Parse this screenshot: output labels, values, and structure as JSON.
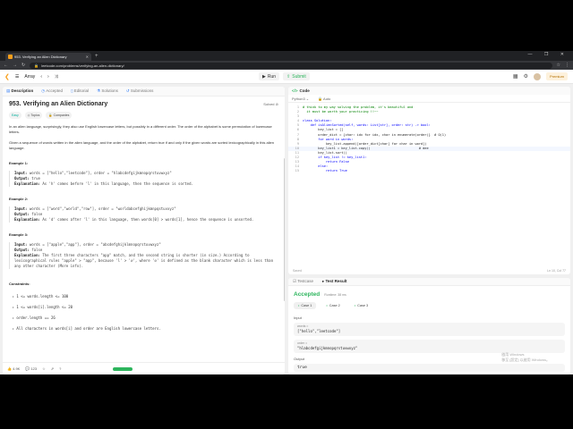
{
  "browser": {
    "tab_title": "953. Verifying an Alien Dictionary",
    "url": "leetcode.com/problems/verifying-an-alien-dictionary/"
  },
  "header": {
    "nav_label": "Array",
    "run_label": "Run",
    "submit_label": "Submit",
    "premium_label": "Premium"
  },
  "left_tabs": [
    "Description",
    "Accepted",
    "Editorial",
    "Solutions",
    "Submissions"
  ],
  "problem": {
    "title": "953. Verifying an Alien Dictionary",
    "solved_label": "Solved",
    "difficulty": "Easy",
    "tag_topics": "Topics",
    "tag_companies": "Companies",
    "desc1": "In an alien language, surprisingly, they also use English lowercase letters, but possibly in a different order. The order of the alphabet is some permutation of lowercase letters.",
    "desc2": "Given a sequence of words written in the alien language, and the order of the alphabet, return true if and only if the given words are sorted lexicographically in this alien language.",
    "examples": [
      {
        "title": "Example 1:",
        "input": "words = [\"hello\",\"leetcode\"], order = \"hlabcdefgijkmnopqrstuvwxyz\"",
        "output": "true",
        "explanation": "As 'h' comes before 'l' in this language, then the sequence is sorted."
      },
      {
        "title": "Example 2:",
        "input": "words = [\"word\",\"world\",\"row\"], order = \"worldabcefghijkmnpqstuvxyz\"",
        "output": "false",
        "explanation": "As 'd' comes after 'l' in this language, then words[0] > words[1], hence the sequence is unsorted."
      },
      {
        "title": "Example 3:",
        "input": "words = [\"apple\",\"app\"], order = \"abcdefghijklmnopqrstuvwxyz\"",
        "output": "false",
        "explanation": "The first three characters \"app\" match, and the second string is shorter (in size.) According to lexicographical rules \"apple\" > \"app\", because 'l' > '∅', where '∅' is defined as the blank character which is less than any other character (More info)."
      }
    ],
    "labels": {
      "input": "Input:",
      "output": "Output:",
      "explanation": "Explanation:"
    },
    "constraints_title": "Constraints:",
    "constraints": [
      "1 <= words.length <= 100",
      "1 <= words[i].length <= 20",
      "order.length == 26",
      "All characters in words[i] and order are English lowercase letters."
    ],
    "likes": "4.9K",
    "comments": "123"
  },
  "editor": {
    "title": "Code",
    "language": "Python3",
    "mode": "Auto",
    "lines": [
      {
        "n": "1",
        "type": "com",
        "text": "# think to my way solving the problem, it's beautiful and"
      },
      {
        "n": "2",
        "type": "com",
        "text": "  it must be worth your practicing !!~~"
      },
      {
        "n": "3",
        "type": "tx",
        "text": ""
      },
      {
        "n": "4",
        "type": "kw",
        "text": "class Solution:"
      },
      {
        "n": "5",
        "type": "kw",
        "text": "    def isAlienSorted(self, words: List[str], order: str) -> bool:"
      },
      {
        "n": "6",
        "type": "tx",
        "text": "        key_list = []"
      },
      {
        "n": "7",
        "type": "tx",
        "text": "        order_dict = {char: idx for idx, char in enumerate(order)}  # O(1)"
      },
      {
        "n": "8",
        "type": "kw",
        "text": "        for word in words:"
      },
      {
        "n": "9",
        "type": "tx",
        "text": "            key_list.append([order_dict[char] for char in word])"
      },
      {
        "n": "10",
        "type": "tx",
        "text": "        key_list1 = key_list.copy()                         # dee"
      },
      {
        "n": "11",
        "type": "tx",
        "text": "        key_list.sort()"
      },
      {
        "n": "12",
        "type": "kw",
        "text": "        if key_list != key_list1:"
      },
      {
        "n": "13",
        "type": "kw",
        "text": "            return False"
      },
      {
        "n": "14",
        "type": "kw",
        "text": "        else:"
      },
      {
        "n": "15",
        "type": "kw",
        "text": "            return True"
      }
    ],
    "status_left": "Saved",
    "status_right": "Ln 10, Col 77"
  },
  "result": {
    "tab_testcase": "Testcase",
    "tab_result": "Test Result",
    "status": "Accepted",
    "runtime": "Runtime: 38 ms",
    "cases": [
      "Case 1",
      "Case 2",
      "Case 3"
    ],
    "input_label": "Input",
    "var1_name": "words =",
    "var1_value": "[\"hello\",\"leetcode\"]",
    "var2_name": "order =",
    "var2_value": "\"hlabcdefgijkmnopqrstuvwxyz\"",
    "output_label": "Output",
    "output_value": "true"
  },
  "watermark": {
    "line1": "啟用 Windows",
    "line2": "移至 [設定] 以啟用 Windows。"
  }
}
